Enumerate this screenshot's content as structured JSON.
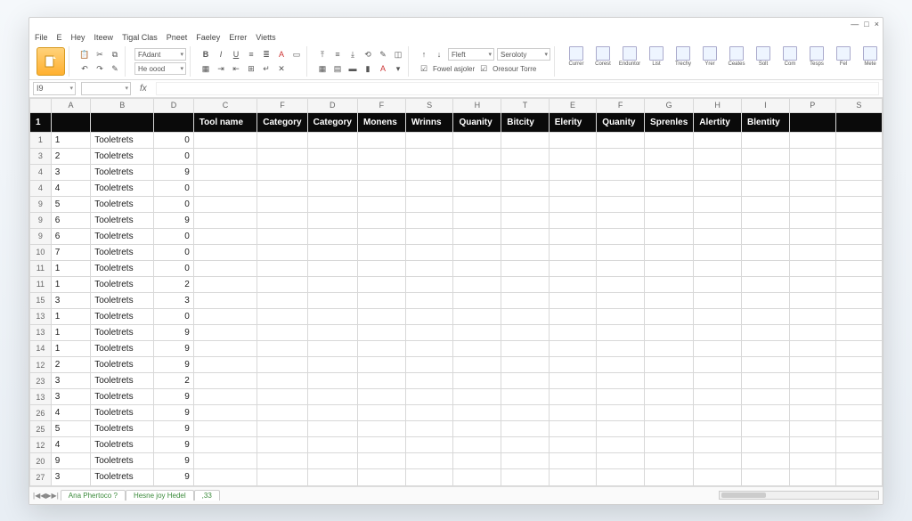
{
  "window": {
    "min": "—",
    "max": "□",
    "close": "×"
  },
  "menu": [
    "File",
    "E",
    "Hey",
    "Iteew",
    "Tigal Clas",
    "Pneet",
    "Faeley",
    "Errer",
    "Vietts"
  ],
  "ribbon": {
    "paste_label": "Paste",
    "font_name": "FAdant",
    "style_name": "He oood",
    "align_sel": "Fleft",
    "wrap_sel": "Seroloty",
    "merge_label": "Fowel asjoler",
    "center_label": "Oresour Torre",
    "buttons": [
      "Currer",
      "Corest",
      "Enduntor",
      "List",
      "Trechy",
      "Yrer",
      "Ceates",
      "Solt",
      "Com",
      "Tesps",
      "Fel",
      "Mete"
    ]
  },
  "formula": {
    "namebox": "I9",
    "fx": "fx",
    "value": ""
  },
  "column_letters": [
    "A",
    "B",
    "D",
    "C",
    "F",
    "D",
    "F",
    "S",
    "H",
    "T",
    "E",
    "F",
    "G",
    "H",
    "I",
    "P",
    "S"
  ],
  "header_row": [
    "",
    "",
    "",
    "Tool name",
    "Category",
    "Category",
    "Monens",
    "Wrinns",
    "Quanity",
    "Bitcity",
    "Elerity",
    "Quanity",
    "Sprenles",
    "Alertity",
    "Blentity",
    "",
    ""
  ],
  "rows": [
    {
      "n": "1",
      "a": "1",
      "b": "Tooletrets",
      "d": "0"
    },
    {
      "n": "3",
      "a": "2",
      "b": "Tooletrets",
      "d": "0"
    },
    {
      "n": "4",
      "a": "3",
      "b": "Tooletrets",
      "d": "9"
    },
    {
      "n": "4",
      "a": "4",
      "b": "Tooletrets",
      "d": "0"
    },
    {
      "n": "9",
      "a": "5",
      "b": "Tooletrets",
      "d": "0"
    },
    {
      "n": "9",
      "a": "6",
      "b": "Tooletrets",
      "d": "9"
    },
    {
      "n": "9",
      "a": "6",
      "b": "Tooletrets",
      "d": "0"
    },
    {
      "n": "10",
      "a": "7",
      "b": "Tooletrets",
      "d": "0"
    },
    {
      "n": "11",
      "a": "1",
      "b": "Tooletrets",
      "d": "0"
    },
    {
      "n": "11",
      "a": "1",
      "b": "Tooletrets",
      "d": "2"
    },
    {
      "n": "15",
      "a": "3",
      "b": "Tooletrets",
      "d": "3"
    },
    {
      "n": "13",
      "a": "1",
      "b": "Tooletrets",
      "d": "0"
    },
    {
      "n": "13",
      "a": "1",
      "b": "Tooletrets",
      "d": "9"
    },
    {
      "n": "14",
      "a": "1",
      "b": "Tooletrets",
      "d": "9"
    },
    {
      "n": "12",
      "a": "2",
      "b": "Tooletrets",
      "d": "9"
    },
    {
      "n": "23",
      "a": "3",
      "b": "Tooletrets",
      "d": "2"
    },
    {
      "n": "13",
      "a": "3",
      "b": "Tooletrets",
      "d": "9"
    },
    {
      "n": "26",
      "a": "4",
      "b": "Tooletrets",
      "d": "9"
    },
    {
      "n": "25",
      "a": "5",
      "b": "Tooletrets",
      "d": "9"
    },
    {
      "n": "12",
      "a": "4",
      "b": "Tooletrets",
      "d": "9"
    },
    {
      "n": "20",
      "a": "9",
      "b": "Tooletrets",
      "d": "9"
    },
    {
      "n": "27",
      "a": "3",
      "b": "Tooletrets",
      "d": "9"
    }
  ],
  "sheets": {
    "nav": [
      "|◀",
      "◀",
      "▶",
      "▶|"
    ],
    "tabs": [
      "Ana Phertoco ?",
      "Hesne joy Hedel",
      ",33"
    ]
  }
}
